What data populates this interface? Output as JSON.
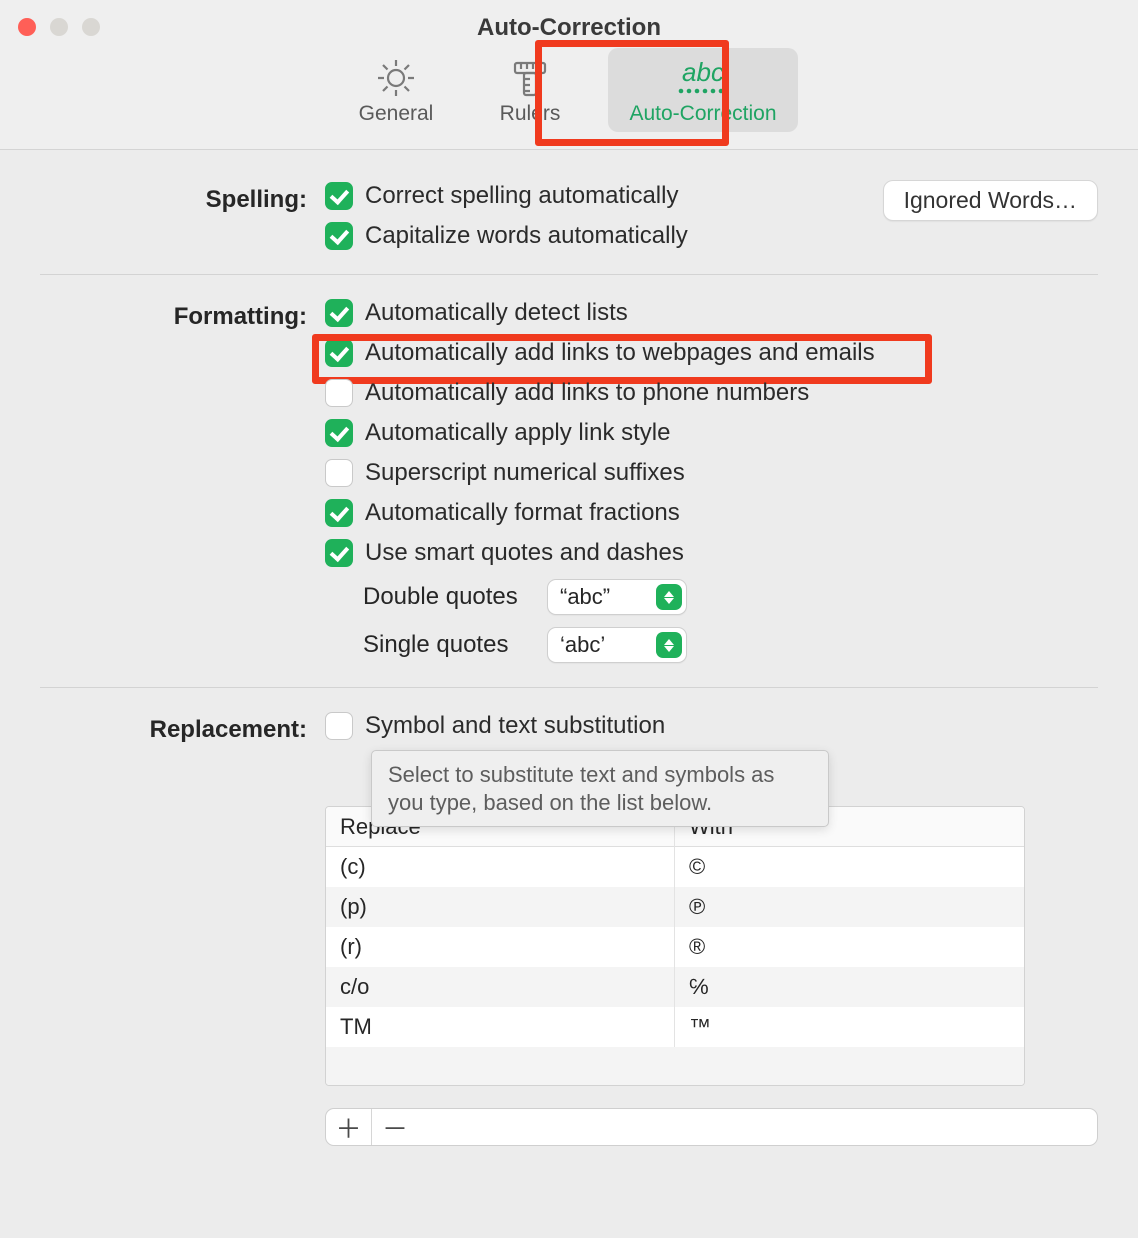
{
  "window": {
    "title": "Auto-Correction"
  },
  "tabs": {
    "general": "General",
    "rulers": "Rulers",
    "auto_correction": "Auto-Correction"
  },
  "sections": {
    "spelling": {
      "title": "Spelling:",
      "correct_automatically": "Correct spelling automatically",
      "capitalize_automatically": "Capitalize words automatically",
      "ignored_words_button": "Ignored Words…"
    },
    "formatting": {
      "title": "Formatting:",
      "detect_lists": "Automatically detect lists",
      "add_links_web_email": "Automatically add links to webpages and emails",
      "add_links_phone": "Automatically add links to phone numbers",
      "apply_link_style": "Automatically apply link style",
      "superscript_suffixes": "Superscript numerical suffixes",
      "format_fractions": "Automatically format fractions",
      "smart_quotes": "Use smart quotes and dashes",
      "double_quotes_label": "Double quotes",
      "double_quotes_value": "“abc”",
      "single_quotes_label": "Single quotes",
      "single_quotes_value": "‘abc’"
    },
    "replacement": {
      "title": "Replacement:",
      "symbol_substitution": "Symbol and text substitution",
      "tooltip": "Select to substitute text and symbols as you type, based on the list below.",
      "table_header_replace": "Replace",
      "table_header_with": "With",
      "rows": [
        {
          "replace": "(c)",
          "with": "©"
        },
        {
          "replace": "(p)",
          "with": "℗"
        },
        {
          "replace": "(r)",
          "with": "®"
        },
        {
          "replace": "c/o",
          "with": "℅"
        },
        {
          "replace": "TM",
          "with": "™"
        }
      ]
    }
  },
  "checkbox_states": {
    "correct_automatically": true,
    "capitalize_automatically": true,
    "detect_lists": true,
    "add_links_web_email": true,
    "add_links_phone": false,
    "apply_link_style": true,
    "superscript_suffixes": false,
    "format_fractions": true,
    "smart_quotes": true,
    "symbol_substitution": false
  }
}
